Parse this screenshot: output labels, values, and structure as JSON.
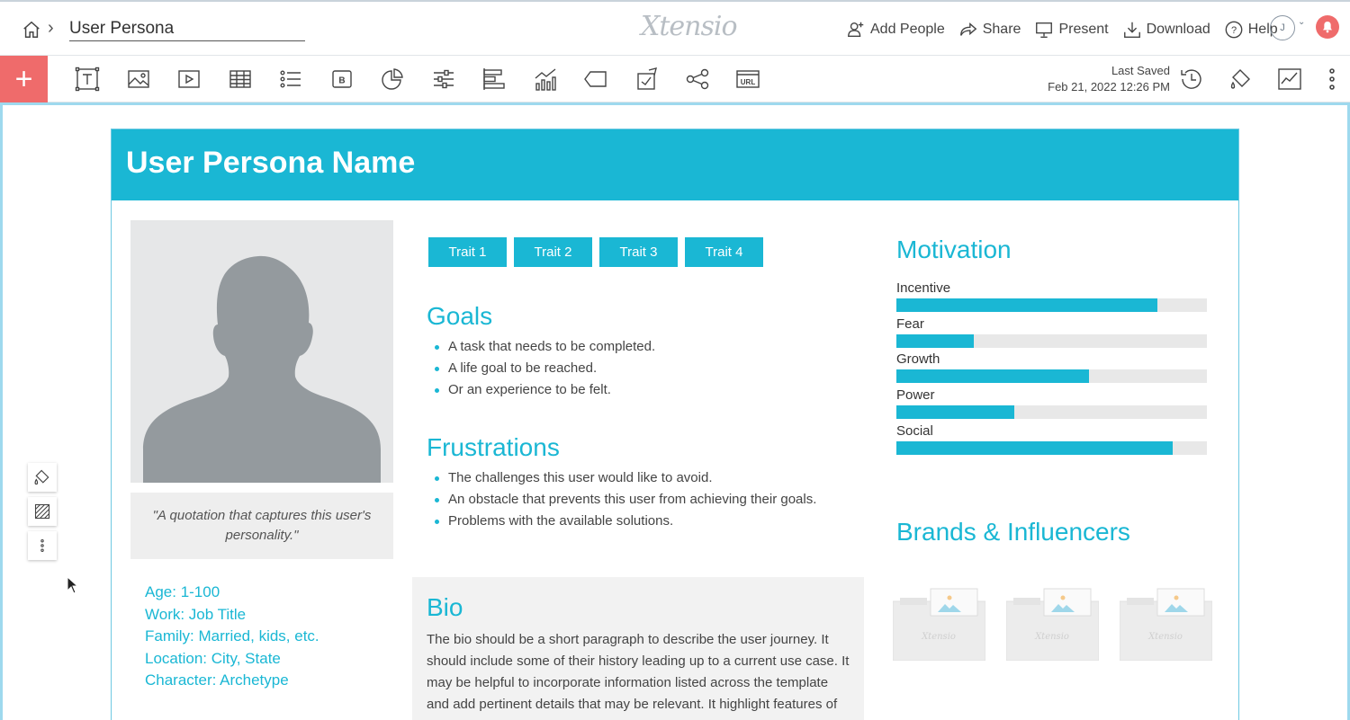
{
  "header": {
    "document_title": "User Persona",
    "logo": "Xtensio",
    "actions": [
      {
        "label": "Add People",
        "icon": "add-person-icon"
      },
      {
        "label": "Share",
        "icon": "share-icon"
      },
      {
        "label": "Present",
        "icon": "present-icon"
      },
      {
        "label": "Download",
        "icon": "download-icon"
      },
      {
        "label": "Help",
        "icon": "help-icon"
      }
    ],
    "avatar_initial": "J"
  },
  "toolbar": {
    "add_label": "+",
    "tools": [
      "text-icon",
      "image-icon",
      "video-icon",
      "table-icon",
      "list-icon",
      "button-icon",
      "pie-chart-icon",
      "slider-icon",
      "bar-chart-icon",
      "line-chart-icon",
      "tag-icon",
      "form-icon",
      "share-nodes-icon",
      "url-icon"
    ],
    "last_saved_label": "Last Saved",
    "last_saved_date": "Feb 21, 2022 12:26 PM",
    "right_tools": [
      "history-icon",
      "paint-bucket-icon",
      "analytics-icon",
      "more-icon"
    ],
    "url_text": "URL",
    "button_text": "B"
  },
  "persona": {
    "name": "User Persona Name",
    "quote": "\"A quotation that captures this user's personality.\"",
    "details": [
      "Age: 1-100",
      "Work: Job Title",
      "Family: Married, kids, etc.",
      "Location: City, State",
      "Character: Archetype"
    ],
    "traits": [
      "Trait 1",
      "Trait 2",
      "Trait 3",
      "Trait 4"
    ],
    "goals_title": "Goals",
    "goals": [
      "A task that needs to be completed.",
      "A life goal to be reached.",
      "Or an experience to be felt."
    ],
    "frustrations_title": "Frustrations",
    "frustrations": [
      "The challenges this user would like to avoid.",
      "An obstacle that prevents this user from achieving their goals.",
      "Problems with the available solutions."
    ],
    "bio_title": "Bio",
    "bio_text": "The bio should be a short paragraph to describe the user journey. It should include some of their history leading up to a current use case. It may be helpful to incorporate information listed across the template and add pertinent details that may be relevant. It highlight features of the persona for each of",
    "motivation_title": "Motivation",
    "motivation": [
      {
        "label": "Incentive",
        "value": 0.84
      },
      {
        "label": "Fear",
        "value": 0.25
      },
      {
        "label": "Growth",
        "value": 0.62
      },
      {
        "label": "Power",
        "value": 0.38
      },
      {
        "label": "Social",
        "value": 0.89
      }
    ],
    "brands_title": "Brands & Influencers",
    "brand_placeholder": "Xtensio",
    "accent_color": "#1ab7d4"
  },
  "colors": {
    "accent": "#1ab7d4",
    "add_button": "#ef6b6b"
  }
}
